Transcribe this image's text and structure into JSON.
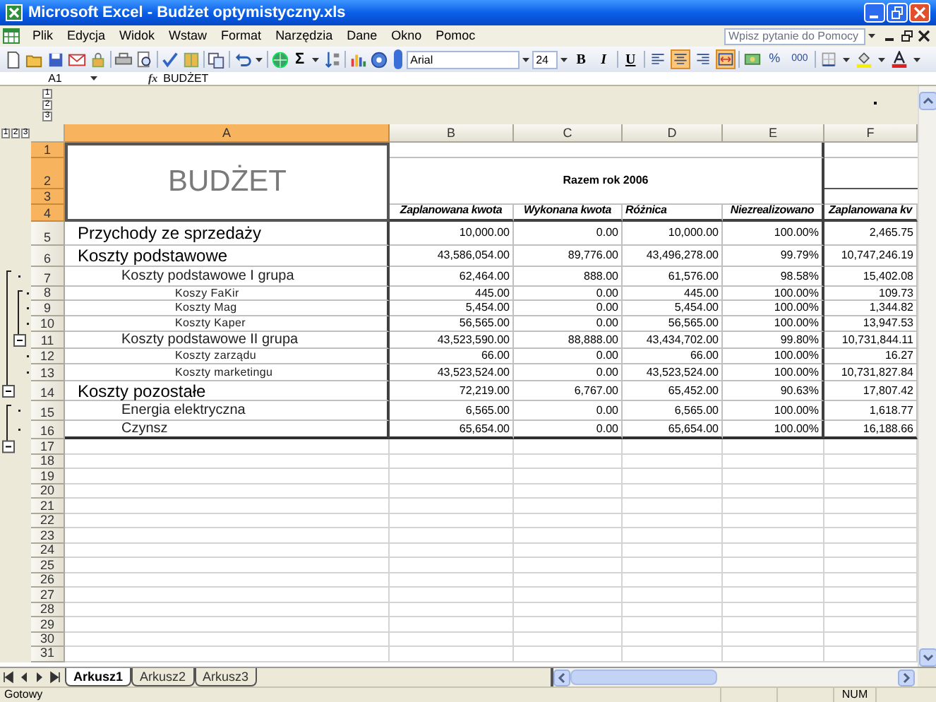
{
  "window": {
    "title": "Microsoft Excel - Budżet optymistyczny.xls"
  },
  "menu": [
    "Plik",
    "Edycja",
    "Widok",
    "Wstaw",
    "Format",
    "Narzędzia",
    "Dane",
    "Okno",
    "Pomoc"
  ],
  "help_box": {
    "placeholder": "Wpisz pytanie do Pomocy"
  },
  "standard_toolbar": {
    "autosum": "Σ"
  },
  "format_toolbar": {
    "font": "Arial",
    "size": "24",
    "buttons": [
      {
        "kind": "bold",
        "label": "B",
        "selected": false
      },
      {
        "kind": "italic",
        "label": "I",
        "selected": false
      },
      {
        "kind": "underline",
        "label": "U",
        "selected": false
      },
      {
        "kind": "align_left",
        "selected": false
      },
      {
        "kind": "align_center",
        "selected": true
      },
      {
        "kind": "align_right",
        "selected": false
      },
      {
        "kind": "merge",
        "selected": true
      },
      {
        "kind": "currency"
      },
      {
        "kind": "percent",
        "label": "%"
      },
      {
        "kind": "thousands",
        "label": "000"
      },
      {
        "kind": "borders"
      },
      {
        "kind": "fill_color"
      },
      {
        "kind": "font_color"
      }
    ]
  },
  "formula_bar": {
    "cell": "A1",
    "function_label": "fx",
    "value": "BUDŻET"
  },
  "outline_levels": {
    "columns": [
      "1",
      "2",
      "3"
    ],
    "rows": [
      "1",
      "2",
      "3"
    ]
  },
  "columns": [
    {
      "label": "A",
      "selected": true
    },
    {
      "label": "B",
      "selected": false
    },
    {
      "label": "C",
      "selected": false
    },
    {
      "label": "D",
      "selected": false
    },
    {
      "label": "E",
      "selected": false
    },
    {
      "label": "F",
      "selected": false
    }
  ],
  "title_cell": "BUDŻET",
  "period_header": "Razem rok 2006",
  "headers": [
    "Zaplanowana kwota",
    "Wykonana kwota",
    "Różnica",
    "Niezrealizowano",
    "Zaplanowana kv"
  ],
  "rows": [
    {
      "number": "1",
      "selected": true
    },
    {
      "number": "2",
      "selected": true
    },
    {
      "number": "3",
      "selected": true
    },
    {
      "number": "4",
      "selected": true
    },
    {
      "number": "5",
      "selected": false,
      "kind": "section",
      "label": "Przychody ze sprzedaży",
      "values": [
        "10,000.00",
        "0.00",
        "10,000.00",
        "100.00%",
        "2,465.75"
      ]
    },
    {
      "number": "6",
      "selected": false,
      "kind": "section",
      "label": "Koszty podstawowe",
      "values": [
        "43,586,054.00",
        "89,776.00",
        "43,496,278.00",
        "99.79%",
        "10,747,246.19"
      ]
    },
    {
      "number": "7",
      "selected": false,
      "kind": "group",
      "outline": {
        "kind": "dot_outer"
      },
      "label": "Koszty podstawowe I grupa",
      "values": [
        "62,464.00",
        "888.00",
        "61,576.00",
        "98.58%",
        "15,402.08"
      ]
    },
    {
      "number": "8",
      "selected": false,
      "kind": "item",
      "outline": {
        "kind": "dot_inner"
      },
      "label": "Koszy FaKir",
      "values": [
        "445.00",
        "0.00",
        "445.00",
        "100.00%",
        "109.73"
      ]
    },
    {
      "number": "9",
      "selected": false,
      "kind": "item",
      "outline": {
        "kind": "dot_inner"
      },
      "label": "Koszty Mag",
      "values": [
        "5,454.00",
        "0.00",
        "5,454.00",
        "100.00%",
        "1,344.82"
      ]
    },
    {
      "number": "10",
      "selected": false,
      "kind": "item",
      "outline": {
        "kind": "dot_inner"
      },
      "label": "Koszty Kaper",
      "values": [
        "56,565.00",
        "0.00",
        "56,565.00",
        "100.00%",
        "13,947.53"
      ]
    },
    {
      "number": "11",
      "selected": false,
      "kind": "group",
      "outline": {
        "kind": "minus_inner"
      },
      "label": "Koszty podstawowe II grupa",
      "values": [
        "43,523,590.00",
        "88,888.00",
        "43,434,702.00",
        "99.80%",
        "10,731,844.11"
      ]
    },
    {
      "number": "12",
      "selected": false,
      "kind": "item",
      "outline": {
        "kind": "dot_inner"
      },
      "label": "Koszty zarządu",
      "values": [
        "66.00",
        "0.00",
        "66.00",
        "100.00%",
        "16.27"
      ]
    },
    {
      "number": "13",
      "selected": false,
      "kind": "item",
      "outline": {
        "kind": "dot_inner"
      },
      "label": "Koszty marketingu",
      "values": [
        "43,523,524.00",
        "0.00",
        "43,523,524.00",
        "100.00%",
        "10,731,827.84"
      ]
    },
    {
      "number": "14",
      "selected": false,
      "kind": "section",
      "outline": {
        "kind": "minus_outer"
      },
      "label": "Koszty pozostałe",
      "values": [
        "72,219.00",
        "6,767.00",
        "65,452.00",
        "90.63%",
        "17,807.42"
      ]
    },
    {
      "number": "15",
      "selected": false,
      "kind": "group",
      "outline": {
        "kind": "dot_outer"
      },
      "label": "Energia elektryczna",
      "values": [
        "6,565.00",
        "0.00",
        "6,565.00",
        "100.00%",
        "1,618.77"
      ]
    },
    {
      "number": "16",
      "selected": false,
      "kind": "group",
      "outline": {
        "kind": "dot_outer"
      },
      "label": "Czynsz",
      "values": [
        "65,654.00",
        "0.00",
        "65,654.00",
        "100.00%",
        "16,188.66"
      ]
    },
    {
      "number": "17",
      "selected": false,
      "outline": {
        "kind": "minus_outer"
      }
    },
    {
      "number": "18",
      "selected": false
    },
    {
      "number": "19",
      "selected": false
    },
    {
      "number": "20",
      "selected": false
    },
    {
      "number": "21",
      "selected": false
    },
    {
      "number": "22",
      "selected": false
    },
    {
      "number": "23",
      "selected": false
    },
    {
      "number": "24",
      "selected": false
    },
    {
      "number": "25",
      "selected": false
    },
    {
      "number": "26",
      "selected": false
    },
    {
      "number": "27",
      "selected": false
    },
    {
      "number": "28",
      "selected": false
    },
    {
      "number": "29",
      "selected": false
    },
    {
      "number": "30",
      "selected": false
    },
    {
      "number": "31",
      "selected": false
    }
  ],
  "sheet_tabs": [
    {
      "label": "Arkusz1",
      "selected": true
    },
    {
      "label": "Arkusz2",
      "selected": false
    },
    {
      "label": "Arkusz3",
      "selected": false
    }
  ],
  "status_bar": {
    "text": "Gotowy",
    "indicators": [
      "NUM"
    ]
  }
}
